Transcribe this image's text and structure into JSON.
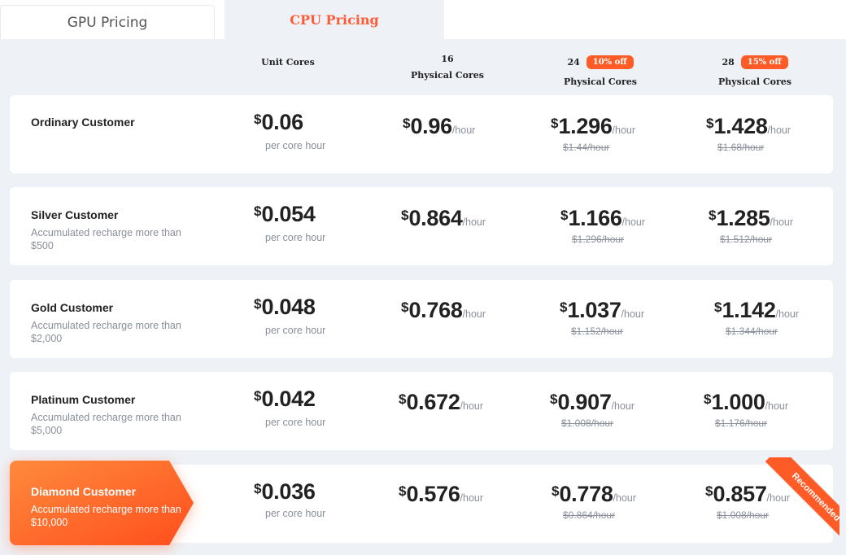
{
  "tabs": [
    {
      "label": "GPU Pricing",
      "active": false
    },
    {
      "label": "CPU Pricing",
      "active": true
    }
  ],
  "columns": [
    {
      "count": "",
      "label": "Unit Cores",
      "badge": ""
    },
    {
      "count": "16",
      "label": "Physical Cores",
      "badge": ""
    },
    {
      "count": "24",
      "label": "Physical Cores",
      "badge": "10% off"
    },
    {
      "count": "28",
      "label": "Physical Cores",
      "badge": "15% off"
    }
  ],
  "currency_symbol": "$",
  "per_core_label": "per core hour",
  "per_hour_label": "/hour",
  "tiers": [
    {
      "name": "Ordinary Customer",
      "desc": "",
      "unit": "0.06",
      "p16": "0.96",
      "p24": "1.296",
      "p24_orig": "$1.44/hour",
      "p28": "1.428",
      "p28_orig": "$1.68/hour"
    },
    {
      "name": "Silver Customer",
      "desc": "Accumulated recharge more than $500",
      "unit": "0.054",
      "p16": "0.864",
      "p24": "1.166",
      "p24_orig": "$1.296/hour",
      "p28": "1.285",
      "p28_orig": "$1.512/hour"
    },
    {
      "name": "Gold Customer",
      "desc": "Accumulated recharge more than $2,000",
      "unit": "0.048",
      "p16": "0.768",
      "p24": "1.037",
      "p24_orig": "$1.152/hour",
      "p28": "1.142",
      "p28_orig": "$1.344/hour"
    },
    {
      "name": "Platinum Customer",
      "desc": "Accumulated recharge more than $5,000",
      "unit": "0.042",
      "p16": "0.672",
      "p24": "0.907",
      "p24_orig": "$1.008/hour",
      "p28": "1.000",
      "p28_orig": "$1.176/hour"
    },
    {
      "name": "Diamond Customer",
      "desc": "Accumulated recharge more than $10,000",
      "unit": "0.036",
      "p16": "0.576",
      "p24": "0.778",
      "p24_orig": "$0.864/hour",
      "p28": "0.857",
      "p28_orig": "$1.008/hour"
    }
  ],
  "recommended_label": "Recommended",
  "colors": {
    "accent": "#ff5b27",
    "background": "#eef1f6",
    "muted_text": "#8a8f99"
  }
}
